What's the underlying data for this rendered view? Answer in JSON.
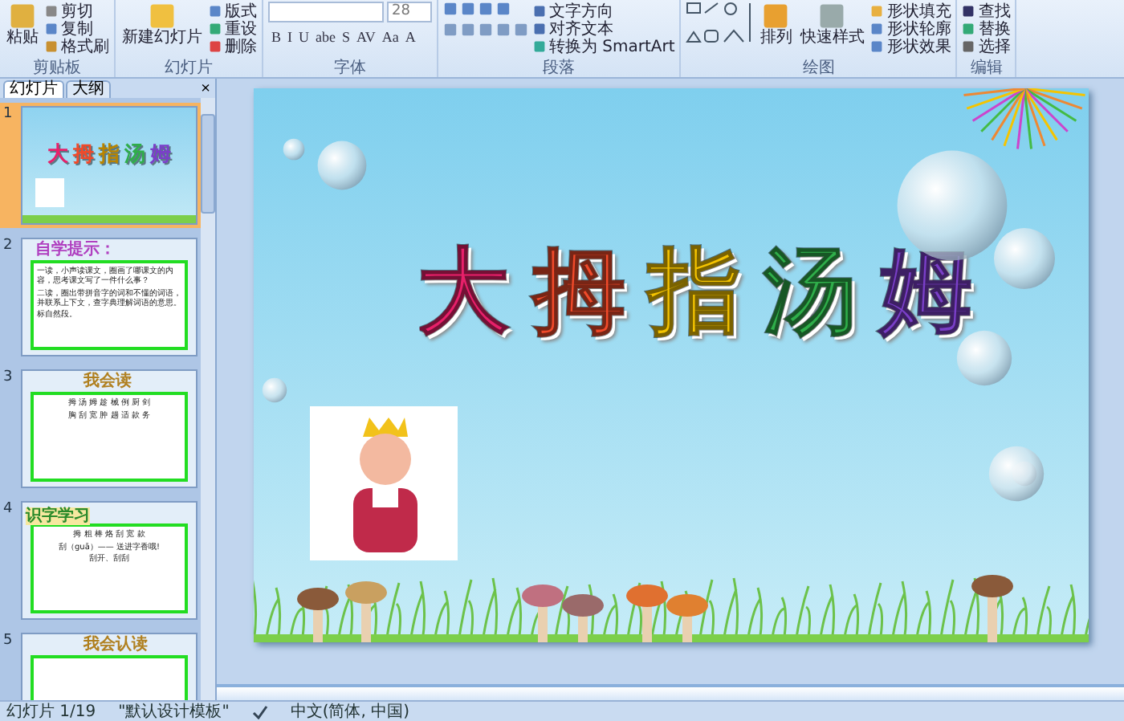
{
  "ribbon": {
    "groups": [
      {
        "label": "剪贴板",
        "large": [
          {
            "label": "粘贴",
            "kind": "paste"
          }
        ],
        "small": [
          {
            "label": "剪切",
            "kind": "cut"
          },
          {
            "label": "复制",
            "kind": "copy"
          },
          {
            "label": "格式刷",
            "kind": "brush"
          }
        ]
      },
      {
        "label": "幻灯片",
        "large": [
          {
            "label": "新建幻灯片",
            "kind": "slide"
          }
        ],
        "small": [
          {
            "label": "版式",
            "kind": "layout"
          },
          {
            "label": "重设",
            "kind": "reset"
          },
          {
            "label": "删除",
            "kind": "delete"
          }
        ]
      },
      {
        "label": "字体",
        "kind": "font",
        "font_size": "28",
        "buttons": [
          "B",
          "I",
          "U",
          "abe",
          "S",
          "AV",
          "Aa",
          "A"
        ]
      },
      {
        "label": "段落",
        "kind": "para",
        "small": [
          {
            "label": "文字方向",
            "kind": "dir"
          },
          {
            "label": "对齐文本",
            "kind": "align"
          },
          {
            "label": "转换为 SmartArt",
            "kind": "smart"
          }
        ]
      },
      {
        "label": "绘图",
        "large": [
          {
            "label": "排列",
            "kind": "arrange"
          },
          {
            "label": "快速样式",
            "kind": "style"
          }
        ],
        "small": [
          {
            "label": "形状填充",
            "kind": "fill"
          },
          {
            "label": "形状轮廓",
            "kind": "outline"
          },
          {
            "label": "形状效果",
            "kind": "effect"
          }
        ]
      },
      {
        "label": "编辑",
        "small": [
          {
            "label": "查找",
            "kind": "find"
          },
          {
            "label": "替换",
            "kind": "replace"
          },
          {
            "label": "选择",
            "kind": "select"
          }
        ]
      }
    ]
  },
  "panel": {
    "tabs": [
      {
        "label": "幻灯片",
        "selected": true
      },
      {
        "label": "大纲",
        "selected": false
      }
    ],
    "close": "×",
    "slides": [
      {
        "number": "1",
        "kind": "title",
        "selected": true,
        "title_chars": [
          {
            "char": "大",
            "color": "#e8206a"
          },
          {
            "char": "拇",
            "color": "#f04a2a"
          },
          {
            "char": "指",
            "color": "#b88400"
          },
          {
            "char": "汤",
            "color": "#2fae4a"
          },
          {
            "char": "姆",
            "color": "#7a3fc8"
          }
        ]
      },
      {
        "number": "2",
        "kind": "text",
        "selected": false,
        "heading": "自学提示：",
        "lines": [
          "一读，小声读课文，圈画了哪课文的内容，思考课文写了一件什么事？",
          "二读，圈出带拼音字的词和不懂的词语，并联系上下文，查字典理解词语的意思。",
          "标自然段。"
        ]
      },
      {
        "number": "3",
        "kind": "words",
        "selected": false,
        "heading": "我会读",
        "lines": [
          "拇 汤 姆 趁 械 例 厨 剑",
          "胸 刮 宽 肿 趟 适 款 务"
        ]
      },
      {
        "number": "4",
        "kind": "words",
        "selected": false,
        "badge": "识字学习",
        "lines": [
          "拇 粗 棒 烙 刮 宽 款",
          "刮（guā）—— 送进字香哦!",
          "刮开、刮刮"
        ]
      },
      {
        "number": "5",
        "kind": "words",
        "selected": false,
        "heading": "我会认读"
      }
    ]
  },
  "slide": {
    "title_chars": [
      {
        "char": "大",
        "color": "#e8206a"
      },
      {
        "char": "拇",
        "color": "#f04a2a"
      },
      {
        "char": "指",
        "color": "#f5c400"
      },
      {
        "char": "汤",
        "color": "#2fae4a"
      },
      {
        "char": "姆",
        "color": "#7a3fc8"
      }
    ]
  },
  "status_bar": {
    "items": [
      "幻灯片 1/19",
      "\"默认设计模板\"",
      "中文(简体, 中国)"
    ]
  }
}
